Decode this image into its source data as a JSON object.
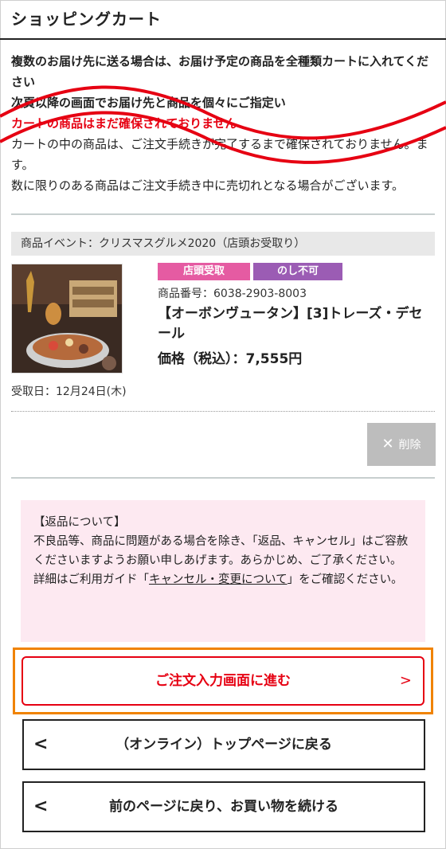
{
  "header": {
    "title": "ショッピングカート"
  },
  "notice": {
    "line1": "複数のお届け先に送る場合は、お届け予定の商品を全種類カートに入れてください",
    "line2": "次頁以降の画面でお届け先と商品を個々にご指定い",
    "warning": "カートの商品はまだ確保されておりません",
    "line3": "カートの中の商品は、ご注文手続きが完了するまで確保されておりません。ます。",
    "line4": "数に限りのある商品はご注文手続き中に売切れとなる場合がございます。"
  },
  "cart": {
    "event_label": "商品イベント：クリスマスグルメ2020（店頭お受取り）",
    "item": {
      "badge_pickup": "店頭受取",
      "badge_noshi": "のし不可",
      "code": "商品番号：6038-2903-8003",
      "name": "【オーボンヴュータン】[3]トレーズ・デセール",
      "price": "価格（税込）：7,555円",
      "pickup_date": "受取日：12月24日(木)"
    },
    "delete_label": "削除"
  },
  "returns": {
    "title": "【返品について】",
    "body": "不良品等、商品に問題がある場合を除き、「返品、キャンセル」はご容赦くださいますようお願い申しあげます。あらかじめ、ご了承ください。",
    "detail_prefix": "詳細はご利用ガイド「",
    "detail_link": "キャンセル・変更について",
    "detail_suffix": "」をご確認ください。"
  },
  "actions": {
    "order_label": "ご注文入力画面に進む",
    "top_label": "（オンライン）トップページに戻る",
    "back_label": "前のページに戻り、お買い物を続ける"
  },
  "colors": {
    "accent_red": "#e60012",
    "highlight_orange": "#f08300",
    "badge_pink": "#e55ba2",
    "badge_purple": "#9b5cb4"
  }
}
